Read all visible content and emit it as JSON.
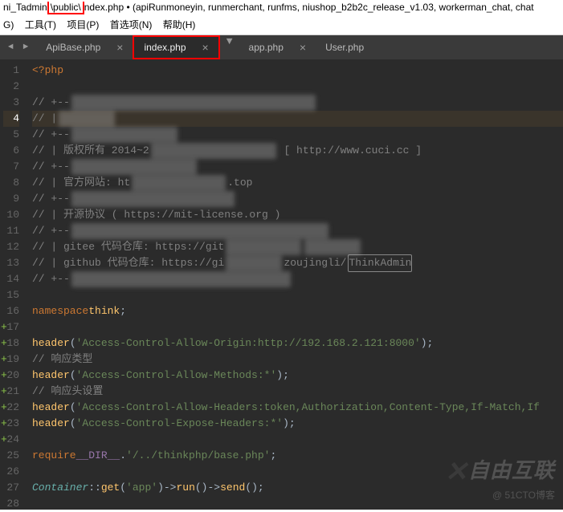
{
  "title_bar": {
    "prefix": "ni_Tadmin",
    "highlighted": "\\public\\",
    "file": "ndex.php",
    "suffix": " • (apiRunmoneyin, runmerchant, runfms, niushop_b2b2c_release_v1.03, workerman_chat, chat"
  },
  "menu": {
    "items": [
      "G)",
      "工具(T)",
      "项目(P)",
      "首选项(N)",
      "帮助(H)"
    ]
  },
  "tabs": {
    "list": [
      {
        "label": "ApiBase.php",
        "active": false,
        "close": "×",
        "highlighted": false
      },
      {
        "label": "index.php",
        "active": true,
        "close": "×",
        "highlighted": true
      },
      {
        "label": "app.php",
        "active": false,
        "close": "×",
        "highlighted": false
      },
      {
        "label": "User.php",
        "active": false,
        "close": "",
        "highlighted": false
      }
    ]
  },
  "code": {
    "lines": [
      {
        "n": "1",
        "plus": false,
        "current": false,
        "html": "<span class='k-tag'>&lt;?</span><span class='k-keyword'>php</span>"
      },
      {
        "n": "2",
        "plus": false,
        "current": false,
        "html": ""
      },
      {
        "n": "3",
        "plus": false,
        "current": false,
        "html": "<span class='k-comment'>// +--</span><span class='blur'>xxxxxxxxxxxxxxxxxxxxxxxxxxxxxxxxxxxxxxx</span>"
      },
      {
        "n": "4",
        "plus": false,
        "current": true,
        "html": "<span class='k-comment'>// |</span> <span class='blur'>xxxxxxxxx</span>"
      },
      {
        "n": "5",
        "plus": false,
        "current": false,
        "html": "<span class='k-comment'>// +--</span><span class='blur'>xxxxxxxxxxxxxxxxx</span>"
      },
      {
        "n": "6",
        "plus": false,
        "current": false,
        "html": "<span class='k-comment'>// | 版权所有 2014~2</span><span class='blur'>xxxxxxxxxxxxxxxxxxxx</span><span class='k-comment'> [ http://www.cuci.cc ]</span>"
      },
      {
        "n": "7",
        "plus": false,
        "current": false,
        "html": "<span class='k-comment'>// +--</span><span class='blur'>xxxxxxxxxxxxxxxxxxxx</span>"
      },
      {
        "n": "8",
        "plus": false,
        "current": false,
        "html": "<span class='k-comment'>// | 官方网站: ht</span><span class='blur'>xxxxxxxxxxxxxxx</span><span class='k-comment'>.top</span>"
      },
      {
        "n": "9",
        "plus": false,
        "current": false,
        "html": "<span class='k-comment'>// +--</span><span class='blur'>xxxxxxxxxxxxxxxxxxxxxxxxxx</span>"
      },
      {
        "n": "10",
        "plus": false,
        "current": false,
        "html": "<span class='k-comment'>// | 开源协议 ( https://mit-license.org )</span>"
      },
      {
        "n": "11",
        "plus": false,
        "current": false,
        "html": "<span class='k-comment'>// +--</span><span class='blur'>xxxxxxxxxxxxxxxxxxxxxxxxxxxxxxxxxxxxxxxxx</span>"
      },
      {
        "n": "12",
        "plus": false,
        "current": false,
        "html": "<span class='k-comment'>// | gitee 代码仓库: https://git</span><span class='blur'>xxxxxxxxxxxx</span>   <span class='blur'>xxxxxxxxx</span>"
      },
      {
        "n": "13",
        "plus": false,
        "current": false,
        "html": "<span class='k-comment'>// | github 代码仓库: https://gi</span><span class='blur'>xxxxxxxxx</span><span class='k-comment'>zoujingli/</span><span class='blur' style='border:1px solid #888;filter:none;color:#808080;background:transparent'>ThinkAdmin</span>"
      },
      {
        "n": "14",
        "plus": false,
        "current": false,
        "html": "<span class='k-comment'>// +--</span><span class='blur'>xxxxxxxxxxxxxxxxxxxxxxxxxxxxxxxxxxx</span>"
      },
      {
        "n": "15",
        "plus": false,
        "current": false,
        "html": ""
      },
      {
        "n": "16",
        "plus": false,
        "current": false,
        "html": "<span class='k-keyword'>namespace</span> <span class='k-think'>think</span><span class='k-punct'>;</span>"
      },
      {
        "n": "17",
        "plus": true,
        "current": false,
        "html": ""
      },
      {
        "n": "18",
        "plus": true,
        "current": false,
        "html": "<span class='k-func'>header</span><span class='k-punct'>(</span><span class='k-string'>'Access-Control-Allow-Origin:http://192.168.2.121:8000'</span><span class='k-punct'>);</span>"
      },
      {
        "n": "19",
        "plus": true,
        "current": false,
        "html": "<span class='k-comment'>// 响应类型</span>"
      },
      {
        "n": "20",
        "plus": true,
        "current": false,
        "html": "<span class='k-func'>header</span><span class='k-punct'>(</span><span class='k-string'>'Access-Control-Allow-Methods:*'</span><span class='k-punct'>);</span>"
      },
      {
        "n": "21",
        "plus": true,
        "current": false,
        "html": "<span class='k-comment'>// 响应头设置</span>"
      },
      {
        "n": "22",
        "plus": true,
        "current": false,
        "html": "<span class='k-func'>header</span><span class='k-punct'>(</span><span class='k-string'>'Access-Control-Allow-Headers:token,Authorization,Content-Type,If-Match,If</span>"
      },
      {
        "n": "23",
        "plus": true,
        "current": false,
        "html": "<span class='k-func'>header</span><span class='k-punct'>(</span><span class='k-string'>'Access-Control-Expose-Headers:*'</span><span class='k-punct'>);</span>"
      },
      {
        "n": "24",
        "plus": true,
        "current": false,
        "html": ""
      },
      {
        "n": "25",
        "plus": false,
        "current": false,
        "html": "<span class='k-keyword'>require</span> <span class='k-const'>__DIR__</span> <span class='k-punct'>.</span> <span class='k-string'>'/../thinkphp/base.php'</span><span class='k-punct'>;</span>"
      },
      {
        "n": "26",
        "plus": false,
        "current": false,
        "html": ""
      },
      {
        "n": "27",
        "plus": false,
        "current": false,
        "html": "<span class='k-class'>Container</span><span class='k-punct'>::</span><span class='k-func'>get</span><span class='k-punct'>(</span><span class='k-string'>'app'</span><span class='k-punct'>)-&gt;</span><span class='k-func'>run</span><span class='k-punct'>()-&gt;</span><span class='k-func'>send</span><span class='k-punct'>();</span>"
      },
      {
        "n": "28",
        "plus": false,
        "current": false,
        "html": ""
      }
    ]
  },
  "watermark": {
    "big": "自由互联",
    "small": "@ 51CTO博客"
  },
  "nav": {
    "left": "◄",
    "right": "►",
    "dropdown": "▼"
  }
}
